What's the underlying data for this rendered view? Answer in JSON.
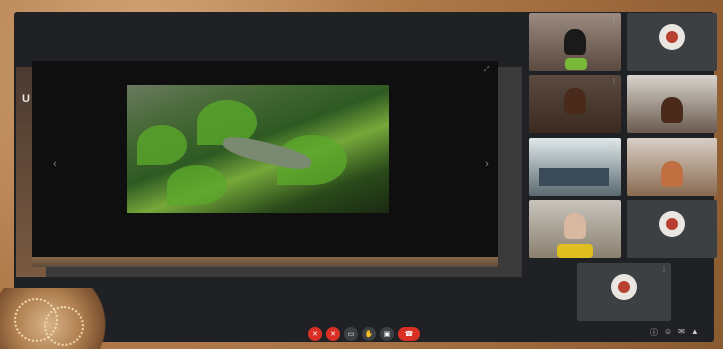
{
  "stage": {
    "left_label": "U",
    "caption": "",
    "nav_prev": "‹",
    "nav_next": "›"
  },
  "participants": [
    {
      "kind": "video",
      "name": ""
    },
    {
      "kind": "avatar",
      "name": ""
    },
    {
      "kind": "video",
      "name": ""
    },
    {
      "kind": "video",
      "name": ""
    },
    {
      "kind": "video",
      "name": ""
    },
    {
      "kind": "video",
      "name": ""
    },
    {
      "kind": "video",
      "name": ""
    },
    {
      "kind": "avatar",
      "name": ""
    },
    {
      "kind": "avatar",
      "name": ""
    }
  ],
  "controls": {
    "mic_icon": "mic-off-icon",
    "camera_icon": "camera-off-icon",
    "end_icon": "call-end-icon"
  },
  "colors": {
    "accent_red": "#d93025",
    "meet_bg": "#202124",
    "tile_bg": "#3c4043"
  }
}
